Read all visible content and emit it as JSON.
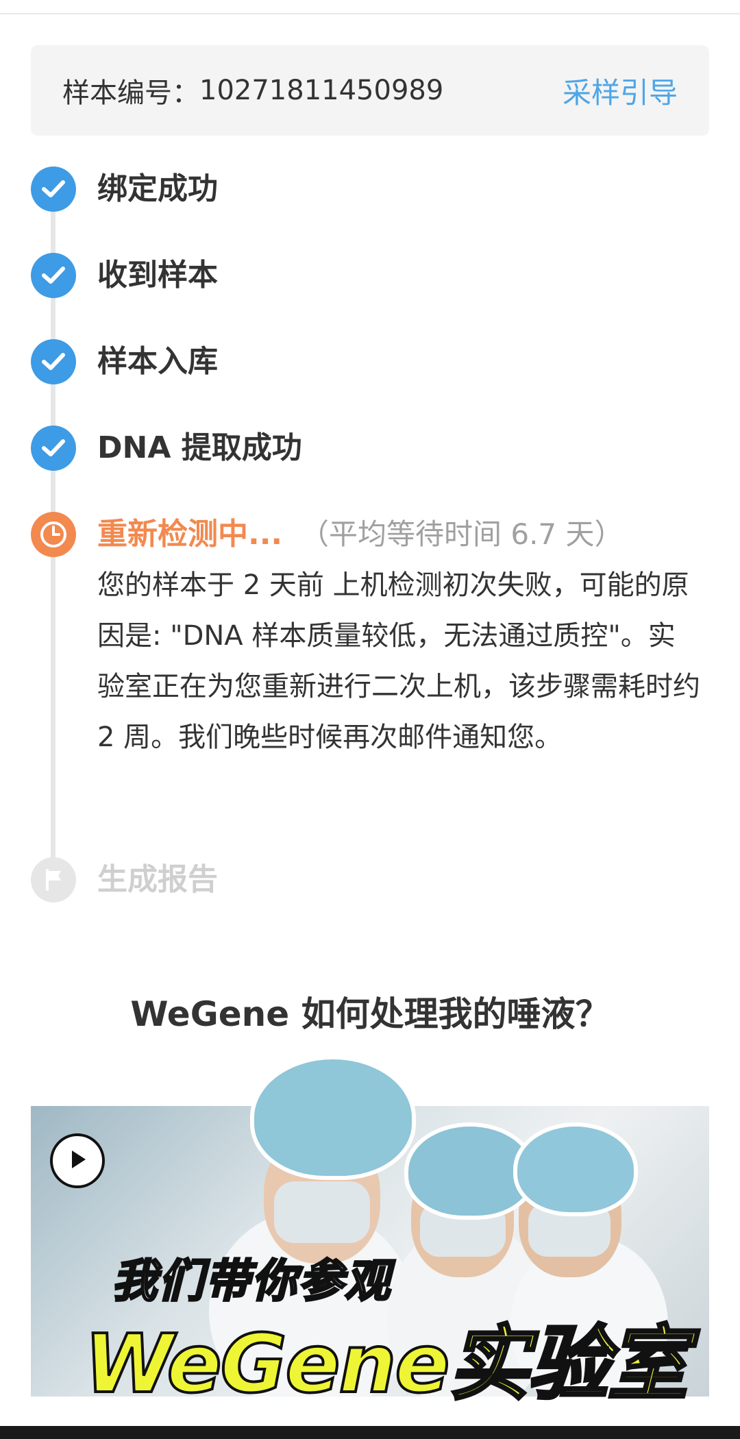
{
  "sample": {
    "label": "样本编号：",
    "number": "10271811450989",
    "guide_link": "采样引导"
  },
  "timeline": {
    "steps": [
      {
        "title": "绑定成功",
        "status": "done",
        "icon": "check-icon"
      },
      {
        "title": "收到样本",
        "status": "done",
        "icon": "check-icon"
      },
      {
        "title": "样本入库",
        "status": "done",
        "icon": "check-icon"
      },
      {
        "title": "DNA 提取成功",
        "status": "done",
        "icon": "check-icon"
      },
      {
        "title": "重新检测中...",
        "status": "in-progress",
        "icon": "clock-icon",
        "wait_note": "（平均等待时间 6.7 天）",
        "description": "您的样本于 2 天前 上机检测初次失败，可能的原因是: \"DNA 样本质量较低，无法通过质控\"。实验室正在为您重新进行二次上机，该步骤需耗时约 2 周。我们晚些时候再次邮件通知您。"
      },
      {
        "title": "生成报告",
        "status": "todo",
        "icon": "flag-icon"
      }
    ]
  },
  "section": {
    "heading": "WeGene 如何处理我的唾液？"
  },
  "video": {
    "caption_top": "我们带你参观",
    "caption_main": "WeGene实验室",
    "play_icon": "play-icon"
  },
  "colors": {
    "done": "#3e9be5",
    "in_progress": "#f2894f",
    "todo": "#e6e6e6",
    "link": "#4ea6e6",
    "caption_highlight": "#eef534"
  }
}
